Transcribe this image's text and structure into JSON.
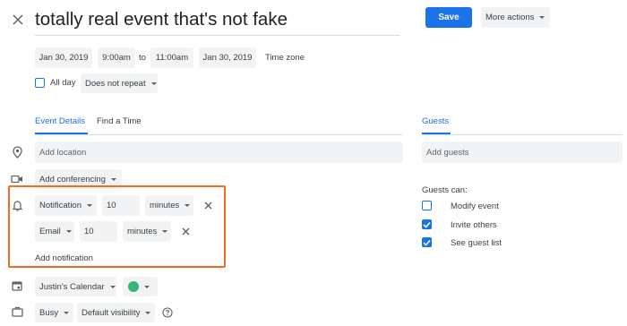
{
  "header": {
    "event_title": "totally real event that's not fake",
    "save_label": "Save",
    "more_actions_label": "More actions"
  },
  "datetime": {
    "start_date": "Jan 30, 2019",
    "start_time": "9:00am",
    "to_label": "to",
    "end_time": "11:00am",
    "end_date": "Jan 30, 2019",
    "time_zone_label": "Time zone",
    "all_day_label": "All day",
    "repeat_value": "Does not repeat"
  },
  "tabs": {
    "event_details": "Event Details",
    "find_a_time": "Find a Time",
    "guests": "Guests"
  },
  "details": {
    "location_placeholder": "Add location",
    "conferencing_label": "Add conferencing",
    "notifications": [
      {
        "type": "Notification",
        "amount": "10",
        "unit": "minutes"
      },
      {
        "type": "Email",
        "amount": "10",
        "unit": "minutes"
      }
    ],
    "add_notification_label": "Add notification",
    "calendar_name": "Justin's Calendar",
    "event_color": "#33b679",
    "busy_value": "Busy",
    "visibility_value": "Default visibility"
  },
  "guests": {
    "add_guests_placeholder": "Add guests",
    "guests_can_label": "Guests can:",
    "permissions": [
      {
        "label": "Modify event",
        "checked": false
      },
      {
        "label": "Invite others",
        "checked": true
      },
      {
        "label": "See guest list",
        "checked": true
      }
    ]
  },
  "colors": {
    "accent": "#1a73e8",
    "highlight_border": "#f26c22"
  },
  "icons": {
    "close": "close-icon",
    "location": "location-pin-icon",
    "video": "video-camera-icon",
    "bell": "bell-icon",
    "calendar": "calendar-icon",
    "briefcase": "briefcase-icon",
    "help": "help-circle-icon"
  }
}
